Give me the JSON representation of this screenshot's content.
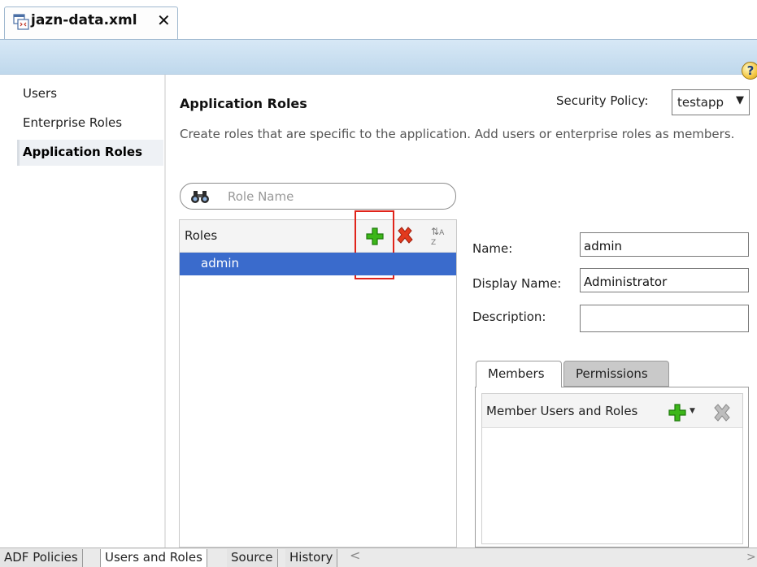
{
  "document_tab": {
    "title": "jazn-data.xml",
    "close_glyph": "✕",
    "icon": "xml-file-icon"
  },
  "help_glyph": "?",
  "left_nav": {
    "items": [
      {
        "label": "Users",
        "selected": false
      },
      {
        "label": "Enterprise Roles",
        "selected": false
      },
      {
        "label": "Application Roles",
        "selected": true
      }
    ]
  },
  "main": {
    "title": "Application Roles",
    "security_policy": {
      "label": "Security Policy:",
      "value": "testapp"
    },
    "description": "Create roles that are specific to the application.  Add users or enterprise roles as members.",
    "search": {
      "placeholder": "Role Name",
      "icon": "binoculars-icon"
    },
    "roles": {
      "header": "Roles",
      "items": [
        "admin"
      ],
      "toolbar": {
        "add_icon": "add-icon",
        "delete_icon": "delete-icon",
        "sort_icon": "sort-az-icon"
      },
      "highlight_color": "#e0241a"
    },
    "details": {
      "name_label": "Name:",
      "name_value": "admin",
      "display_name_label": "Display Name:",
      "display_name_value": "Administrator",
      "description_label": "Description:",
      "description_value": ""
    },
    "detail_tabs": [
      {
        "label": "Members",
        "active": true
      },
      {
        "label": "Permissions",
        "active": false
      }
    ],
    "members": {
      "header": "Member Users and Roles"
    }
  },
  "bottom_tabs": [
    {
      "label": "ADF Policies",
      "active": false
    },
    {
      "label": "Users and Roles",
      "active": true
    },
    {
      "label": "Source",
      "active": false
    },
    {
      "label": "History",
      "active": false
    }
  ],
  "colors": {
    "selection": "#3a6bcc",
    "header_band": "#cfe2f3",
    "add_green": "#3cb619",
    "delete_red": "#e23a1e"
  }
}
